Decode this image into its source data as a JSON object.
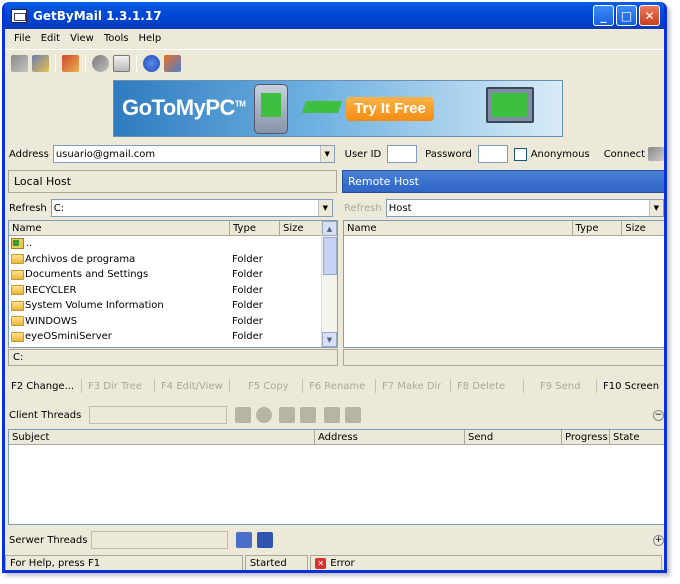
{
  "window": {
    "title": "GetByMail 1.3.1.17",
    "accent": "#0a5ee6"
  },
  "menu": {
    "items": [
      "File",
      "Edit",
      "View",
      "Tools",
      "Help"
    ]
  },
  "toolbar": {
    "icons": [
      "users-icon",
      "users-add-icon",
      "gift-icon",
      "gear-icon",
      "mail-icon",
      "help-icon",
      "home-icon"
    ]
  },
  "banner": {
    "brand": "GoToMyPC",
    "tm": "TM",
    "cta": "Try It Free"
  },
  "address_row": {
    "address_label": "Address",
    "address_value": "usuario@gmail.com",
    "userid_label": "User ID",
    "password_label": "Password",
    "anonymous_label": "Anonymous",
    "connect_label": "Connect"
  },
  "local": {
    "header": "Local Host",
    "refresh_label": "Refresh",
    "path": "C:",
    "columns": [
      "Name",
      "Type",
      "Size"
    ],
    "files": [
      {
        "name": "..",
        "type": ""
      },
      {
        "name": "Archivos de programa",
        "type": "Folder"
      },
      {
        "name": "Documents and Settings",
        "type": "Folder"
      },
      {
        "name": "RECYCLER",
        "type": "Folder"
      },
      {
        "name": "System Volume Information",
        "type": "Folder"
      },
      {
        "name": "WINDOWS",
        "type": "Folder"
      },
      {
        "name": "eyeOSminiServer",
        "type": "Folder"
      }
    ],
    "status": "C:"
  },
  "remote": {
    "header": "Remote Host",
    "refresh_label": "Refresh",
    "host": "Host",
    "columns": [
      "Name",
      "Type",
      "Size"
    ]
  },
  "function_keys": [
    {
      "label": "F2 Change...",
      "enabled": true
    },
    {
      "label": "F3 Dir Tree",
      "enabled": false
    },
    {
      "label": "F4 Edit/View",
      "enabled": false
    },
    {
      "label": "F5 Copy",
      "enabled": false
    },
    {
      "label": "F6 Rename",
      "enabled": false
    },
    {
      "label": "F7 Make Dir",
      "enabled": false
    },
    {
      "label": "F8 Delete",
      "enabled": false
    },
    {
      "label": "F9 Send",
      "enabled": false
    },
    {
      "label": "F10 Screen",
      "enabled": true
    }
  ],
  "client_threads": {
    "label": "Client Threads",
    "columns": [
      "Subject",
      "Address",
      "Send",
      "Progress",
      "State"
    ]
  },
  "server_threads": {
    "label": "Serwer Threads"
  },
  "statusbar": {
    "help": "For Help, press F1",
    "state": "Started",
    "error": "Error"
  }
}
